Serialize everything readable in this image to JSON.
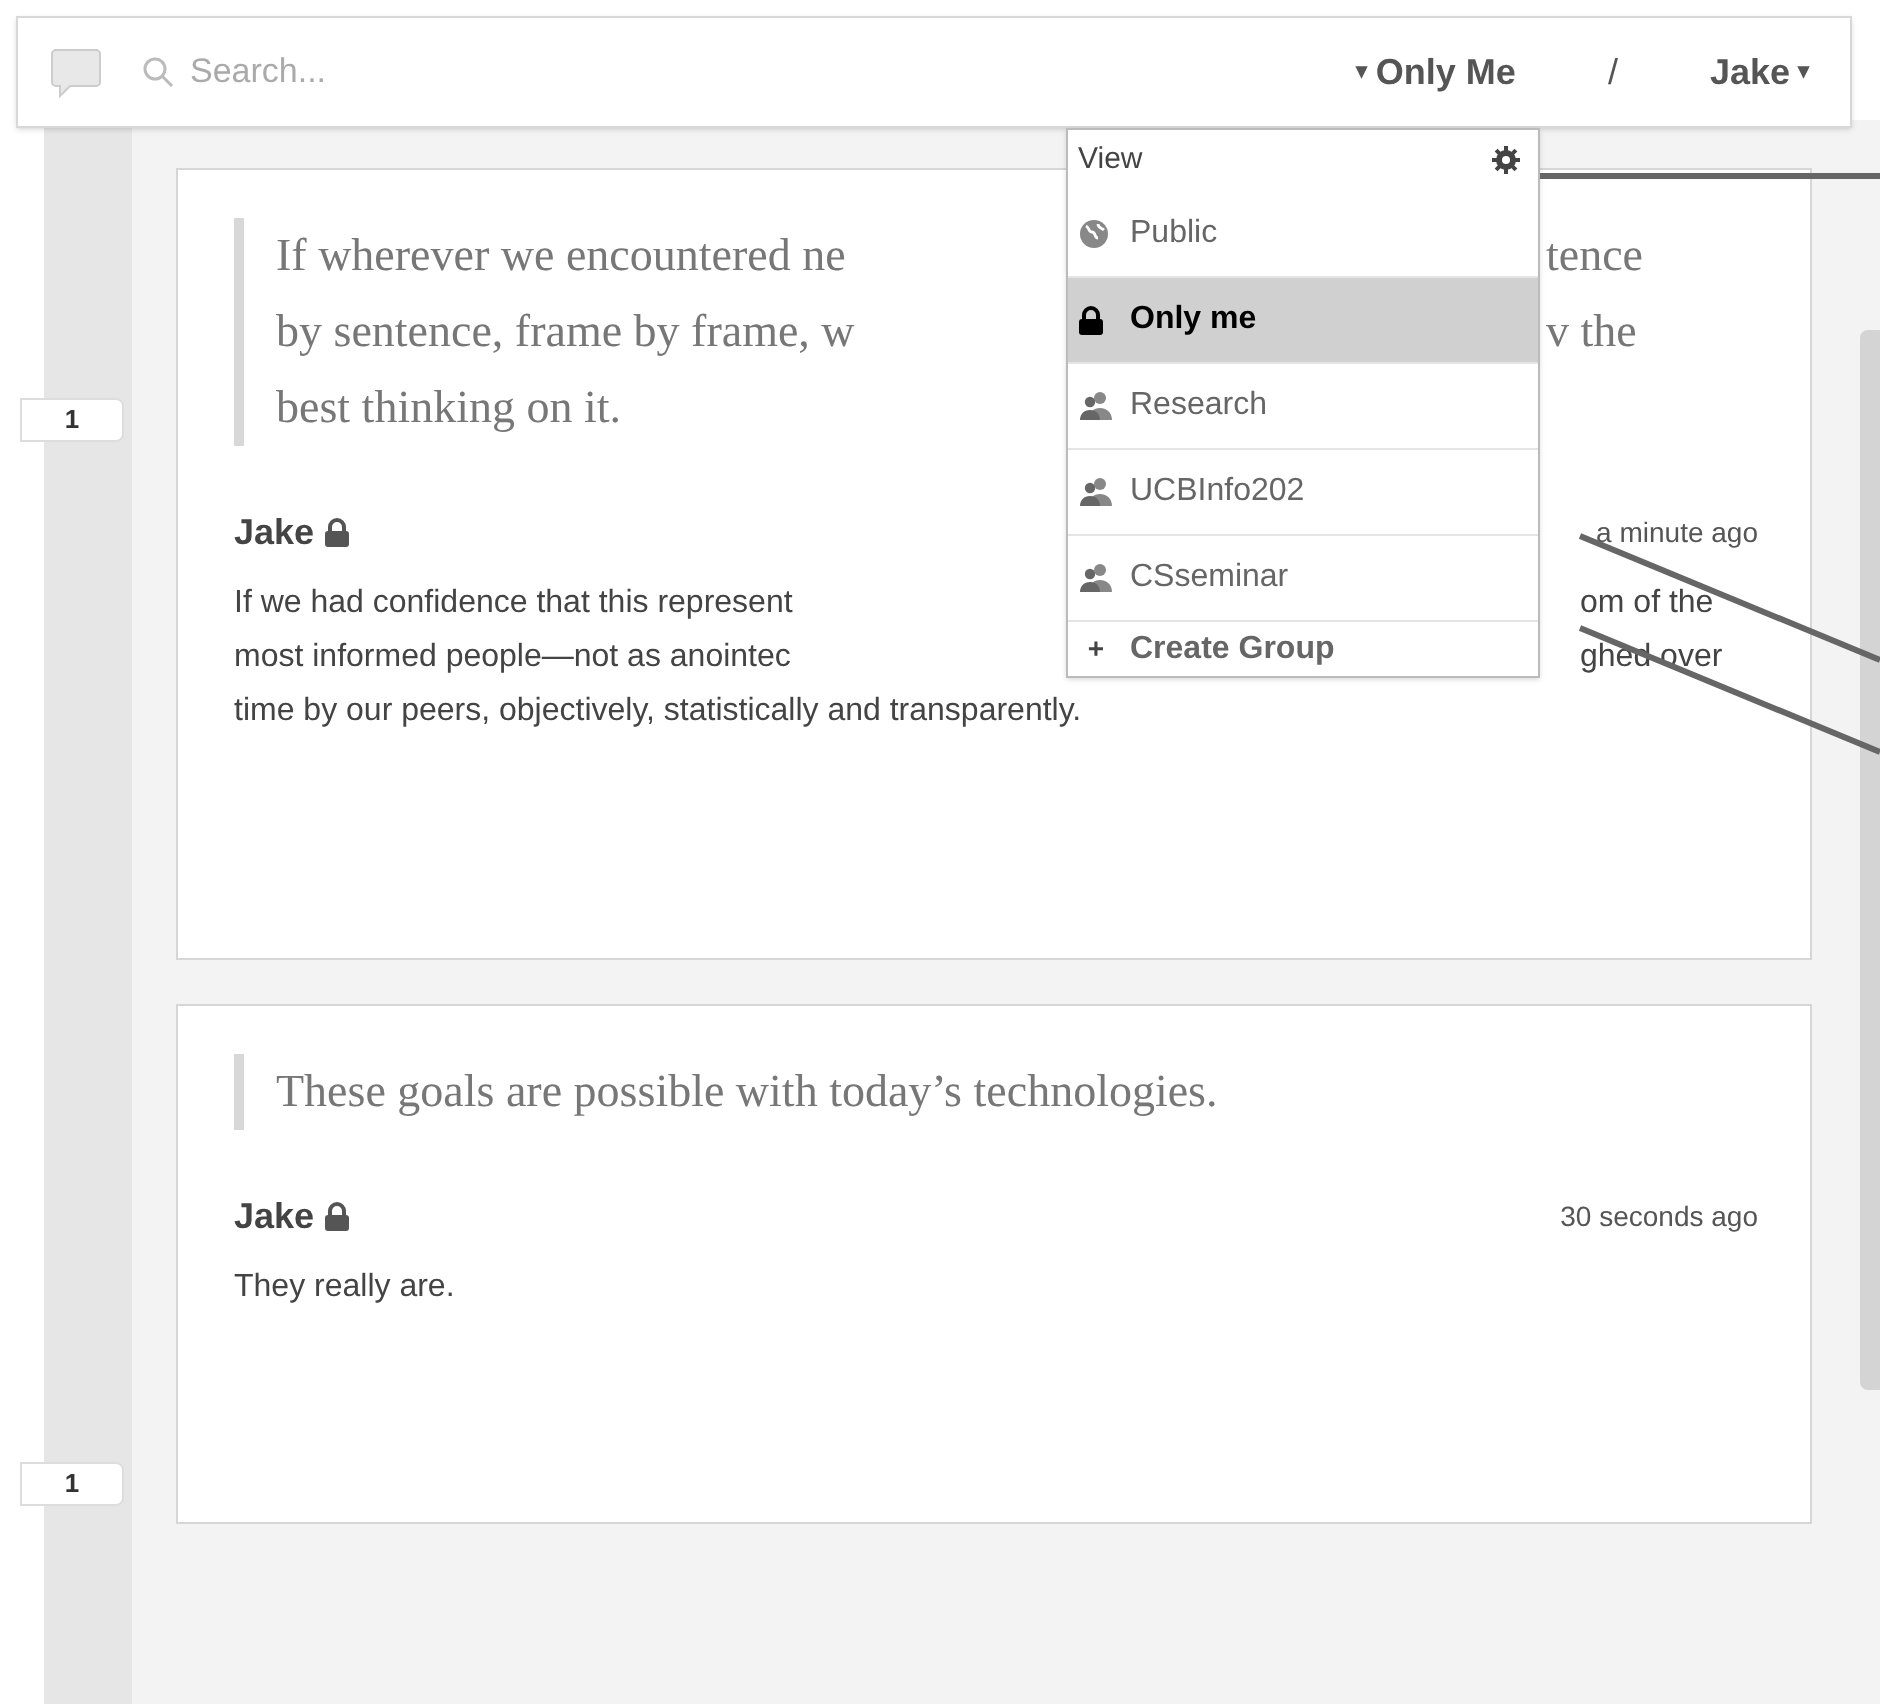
{
  "toolbar": {
    "search": {
      "placeholder": "Search..."
    },
    "scope": {
      "caret": "▾",
      "label": "Only Me"
    },
    "separator": "/",
    "user": {
      "label": "Jake",
      "caret": "▾"
    }
  },
  "dropdown": {
    "title": "View",
    "items": [
      {
        "kind": "public",
        "label": "Public",
        "selected": false
      },
      {
        "kind": "private",
        "label": "Only me",
        "selected": true
      },
      {
        "kind": "group",
        "label": "Research",
        "selected": false
      },
      {
        "kind": "group",
        "label": "UCBInfo202",
        "selected": false
      },
      {
        "kind": "group",
        "label": "CSseminar",
        "selected": false
      },
      {
        "kind": "action",
        "symbol": "+",
        "label": "Create Group",
        "selected": false
      }
    ]
  },
  "annotations": [
    {
      "quote_lines": [
        {
          "left": "If wherever we encountered ne",
          "right": "tence"
        },
        {
          "left": "by sentence, frame by frame, w",
          "right": "v the"
        },
        {
          "left": "best thinking on it."
        }
      ],
      "user": "Jake",
      "private": true,
      "time": "a minute ago",
      "count": "1",
      "body_lines": [
        {
          "left": "If we had confidence that this represent",
          "right": "om of the"
        },
        {
          "left": "most informed people—not as anointec",
          "right": "ghed over"
        },
        {
          "left": "time by our peers, objectively, statistically and transparently."
        }
      ]
    },
    {
      "quote_lines": [
        {
          "left": "These goals are possible with today’s technologies."
        }
      ],
      "user": "Jake",
      "private": true,
      "time": "30 seconds ago",
      "count": "1",
      "body_lines": [
        {
          "left": "They really are."
        }
      ]
    }
  ]
}
